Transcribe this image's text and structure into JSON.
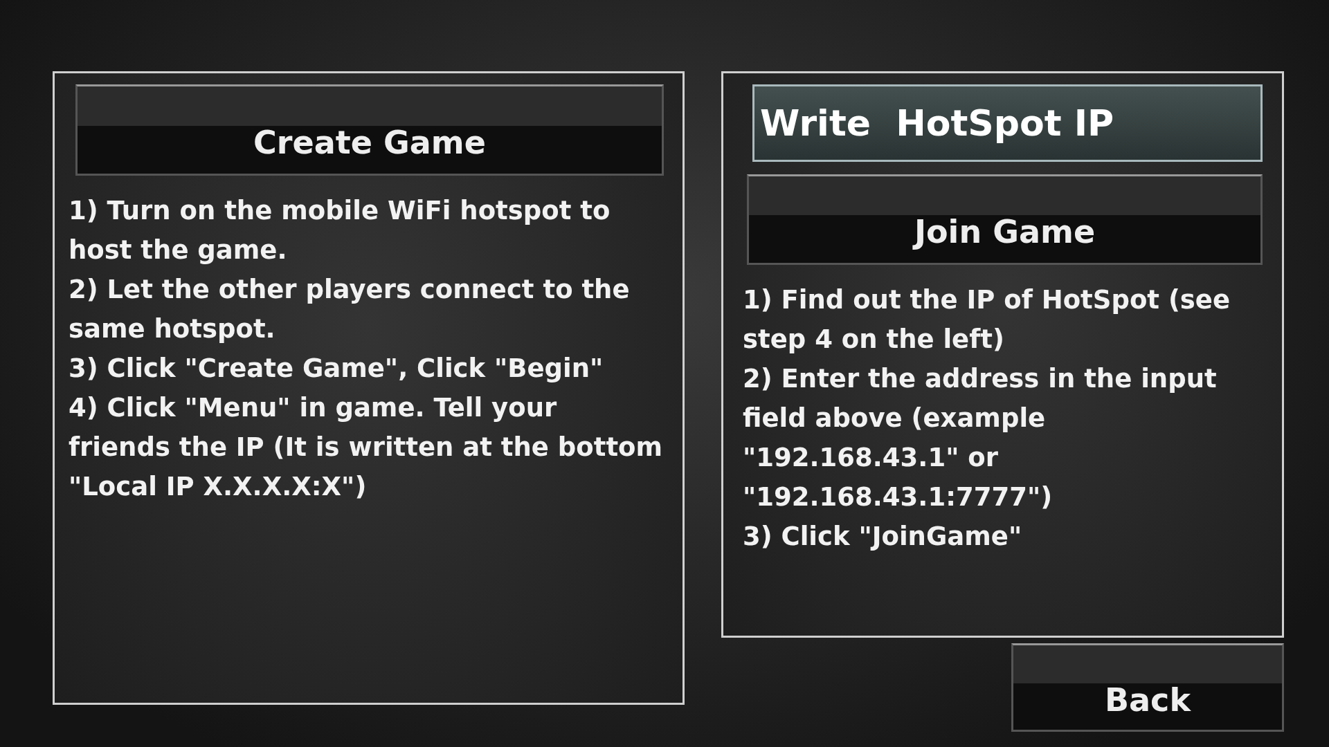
{
  "create_panel": {
    "button": "Create Game",
    "steps": [
      "1) Turn on the mobile WiFi hotspot to host the game.",
      "2) Let the other players connect to the same hotspot.",
      "3) Click \"Create Game\", Click \"Begin\"",
      "4) Click \"Menu\" in game. Tell your friends the IP (It is written at the bottom \"Local IP X.X.X.X:X\")"
    ]
  },
  "join_panel": {
    "ip_field": {
      "placeholder": "Write  HotSpot IP"
    },
    "button": "Join Game",
    "steps": [
      "1) Find out the IP of HotSpot (see step 4 on the left)",
      "2) Enter the address in the input field above (example \"192.168.43.1\" or \"192.168.43.1:7777\")",
      "3) Click \"JoinGame\""
    ]
  },
  "back_button": "Back"
}
